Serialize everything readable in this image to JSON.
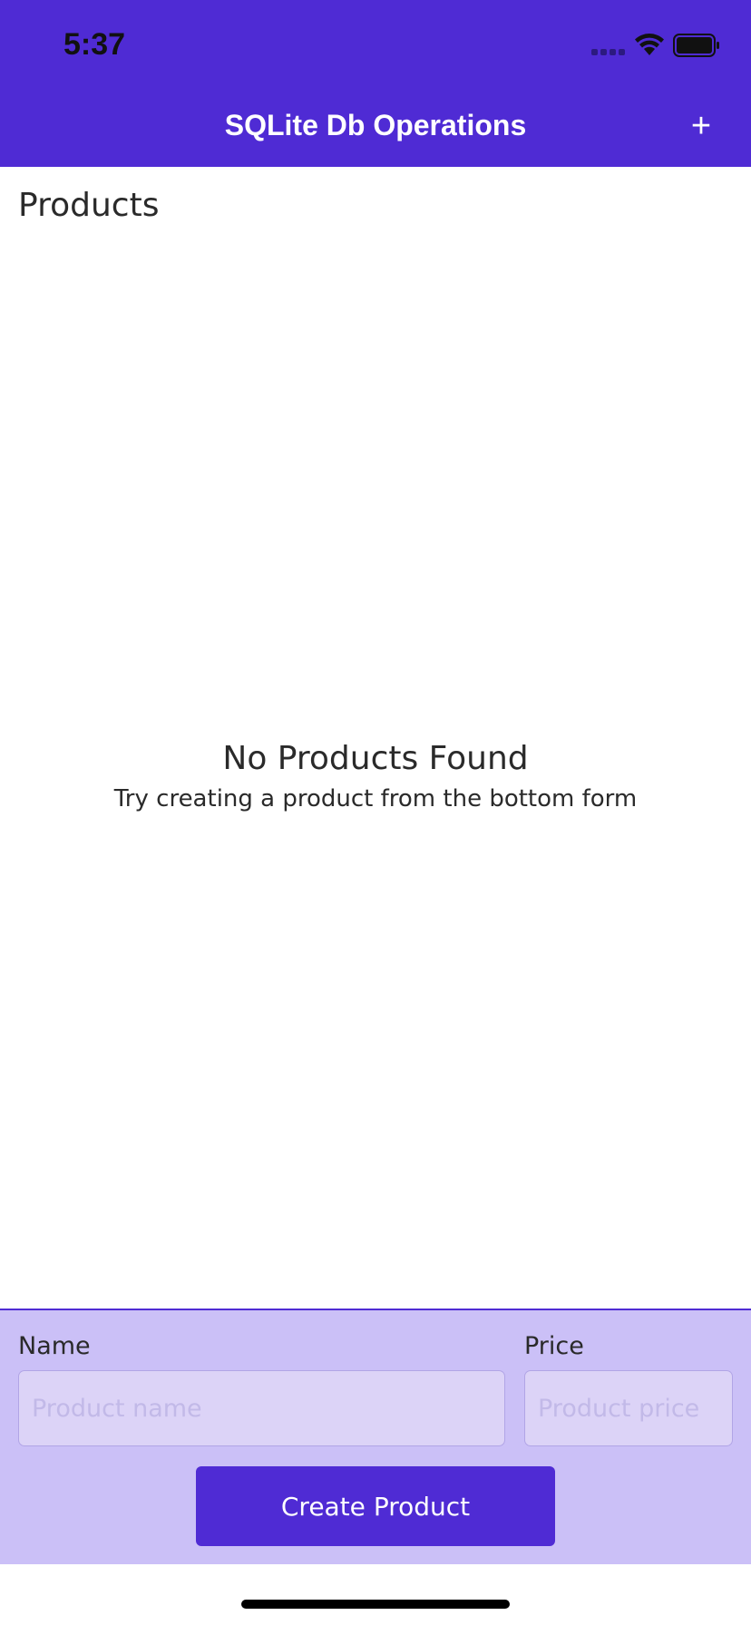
{
  "status_bar": {
    "time": "5:37",
    "icons": [
      "cellular-signal-icon",
      "wifi-icon",
      "battery-icon"
    ]
  },
  "navbar": {
    "title": "SQLite Db Operations",
    "add_label": "+"
  },
  "products": {
    "section_title": "Products",
    "empty_title": "No Products Found",
    "empty_subtitle": "Try creating a product from the bottom form"
  },
  "form": {
    "name_label": "Name",
    "name_placeholder": "Product name",
    "name_value": "",
    "price_label": "Price",
    "price_placeholder": "Product price",
    "price_value": "",
    "create_label": "Create Product"
  },
  "colors": {
    "primary": "#4f2bd4",
    "form_background": "#cbc0f7",
    "input_background": "#dcd3f7"
  }
}
